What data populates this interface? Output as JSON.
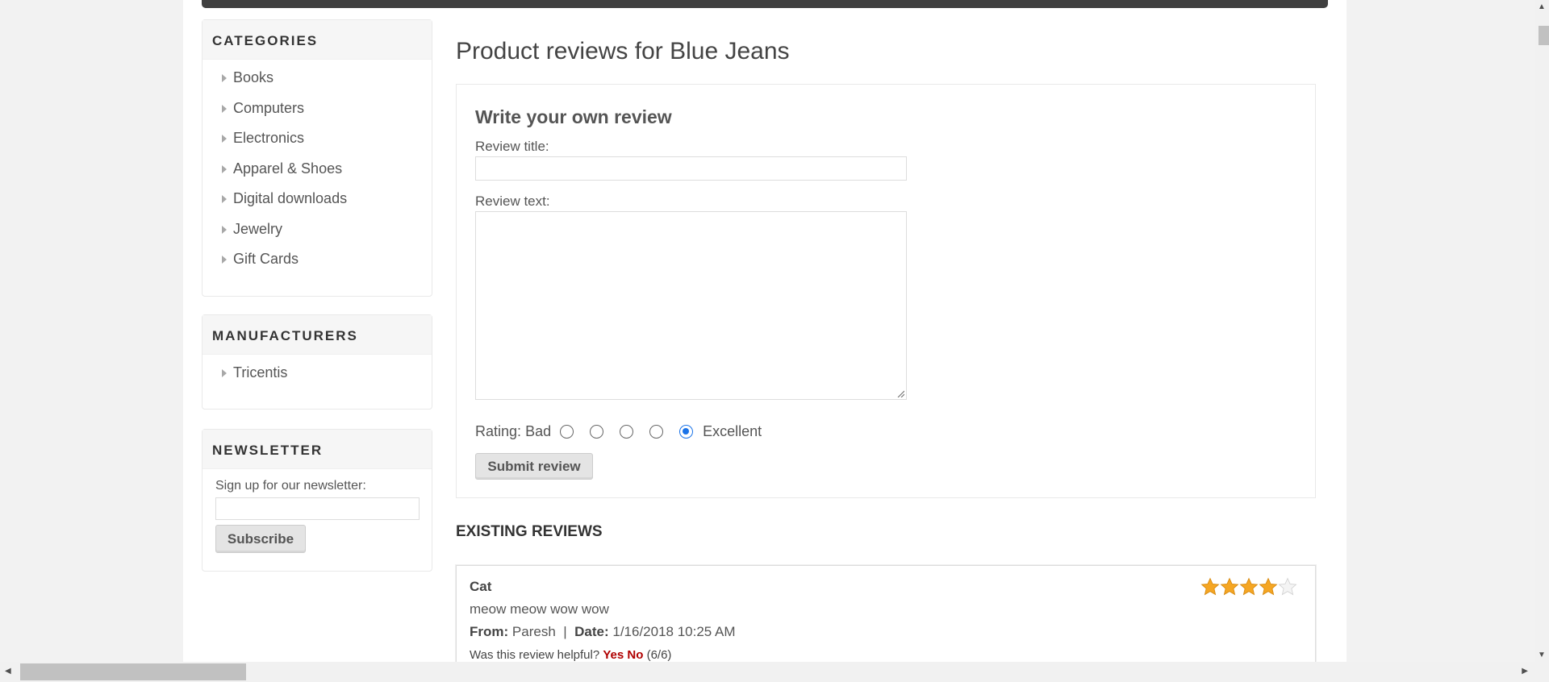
{
  "sidebar": {
    "categories": {
      "title": "CATEGORIES",
      "items": [
        {
          "label": "Books"
        },
        {
          "label": "Computers"
        },
        {
          "label": "Electronics"
        },
        {
          "label": "Apparel & Shoes"
        },
        {
          "label": "Digital downloads"
        },
        {
          "label": "Jewelry"
        },
        {
          "label": "Gift Cards"
        }
      ]
    },
    "manufacturers": {
      "title": "MANUFACTURERS",
      "items": [
        {
          "label": "Tricentis"
        }
      ]
    },
    "newsletter": {
      "title": "NEWSLETTER",
      "label": "Sign up for our newsletter:",
      "input_value": "",
      "button_label": "Subscribe"
    }
  },
  "main": {
    "page_title": "Product reviews for Blue Jeans",
    "write_review": {
      "title": "Write your own review",
      "review_title_label": "Review title:",
      "review_title_value": "",
      "review_text_label": "Review text:",
      "review_text_value": "",
      "rating_label": "Rating:",
      "rating_bad": "Bad",
      "rating_excellent": "Excellent",
      "rating_selected": 5,
      "rating_options": 5,
      "submit_label": "Submit review"
    },
    "existing_reviews": {
      "title": "EXISTING REVIEWS",
      "reviews": [
        {
          "title": "Cat",
          "text": "meow meow wow wow",
          "from_label": "From:",
          "from": "Paresh",
          "separator": "|",
          "date_label": "Date:",
          "date": "1/16/2018 10:25 AM",
          "helpful_question": "Was this review helpful?",
          "yes_label": "Yes",
          "no_label": "No",
          "helpful_count": "(6/6)",
          "rating": 4,
          "rating_max": 5
        }
      ]
    }
  },
  "colors": {
    "accent_vote": "#b00000",
    "star_filled": "#f5a623",
    "star_empty": "#dddddd",
    "radio_selected": "#1a73e8"
  }
}
